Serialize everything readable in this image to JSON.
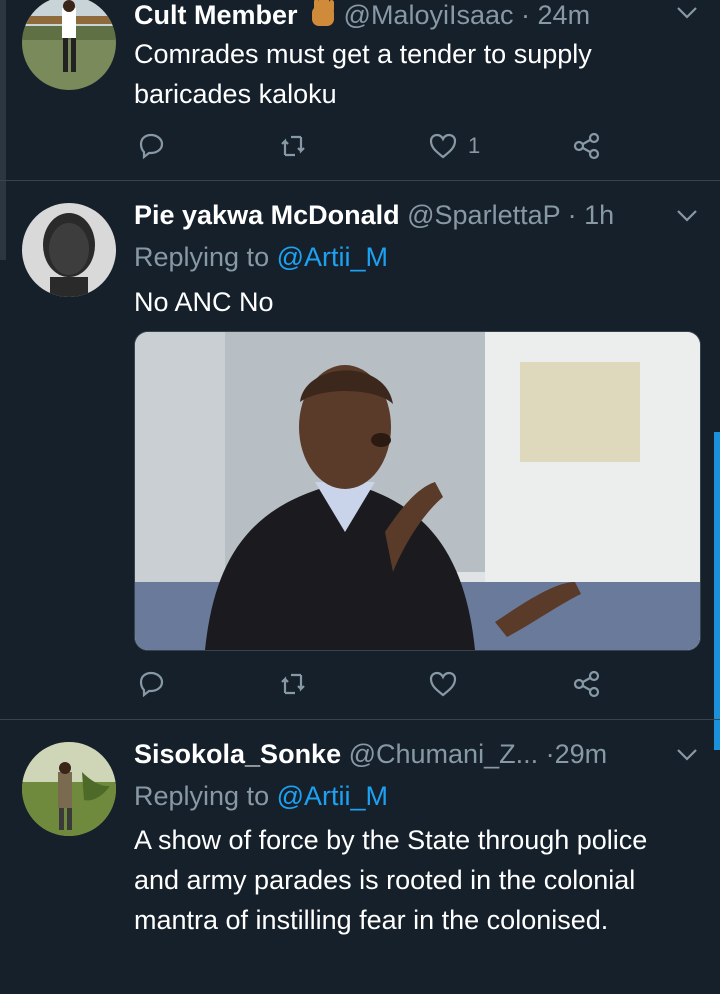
{
  "tweets": [
    {
      "name": "Cult Member",
      "handle": "@MaloyiIsaac",
      "dot": "·",
      "time": "24m",
      "emoji": "raised-fist-emoji",
      "text": "Comrades must get a tender to supply baricades kaloku",
      "like_count": "1"
    },
    {
      "name": "Pie yakwa McDonald",
      "handle": "@SparlettaP",
      "dot": "·",
      "time": "1h",
      "replying_label": "Replying to",
      "replying_to": "@Artii_M",
      "text": "No ANC No",
      "like_count": ""
    },
    {
      "name": "Sisokola_Sonke",
      "handle": "@Chumani_Z...",
      "dot": "·",
      "time": "29m",
      "replying_label": "Replying to",
      "replying_to": "@Artii_M",
      "text": "A show of force by the State through police and army parades is rooted in the colonial mantra of instilling fear in the colonised."
    }
  ],
  "colors": {
    "background": "#15202b",
    "secondary_text": "#8899a6",
    "link": "#1da1f2",
    "divider": "#38444d"
  },
  "icons": [
    "reply-icon",
    "retweet-icon",
    "like-icon",
    "share-icon",
    "chevron-down-icon"
  ]
}
